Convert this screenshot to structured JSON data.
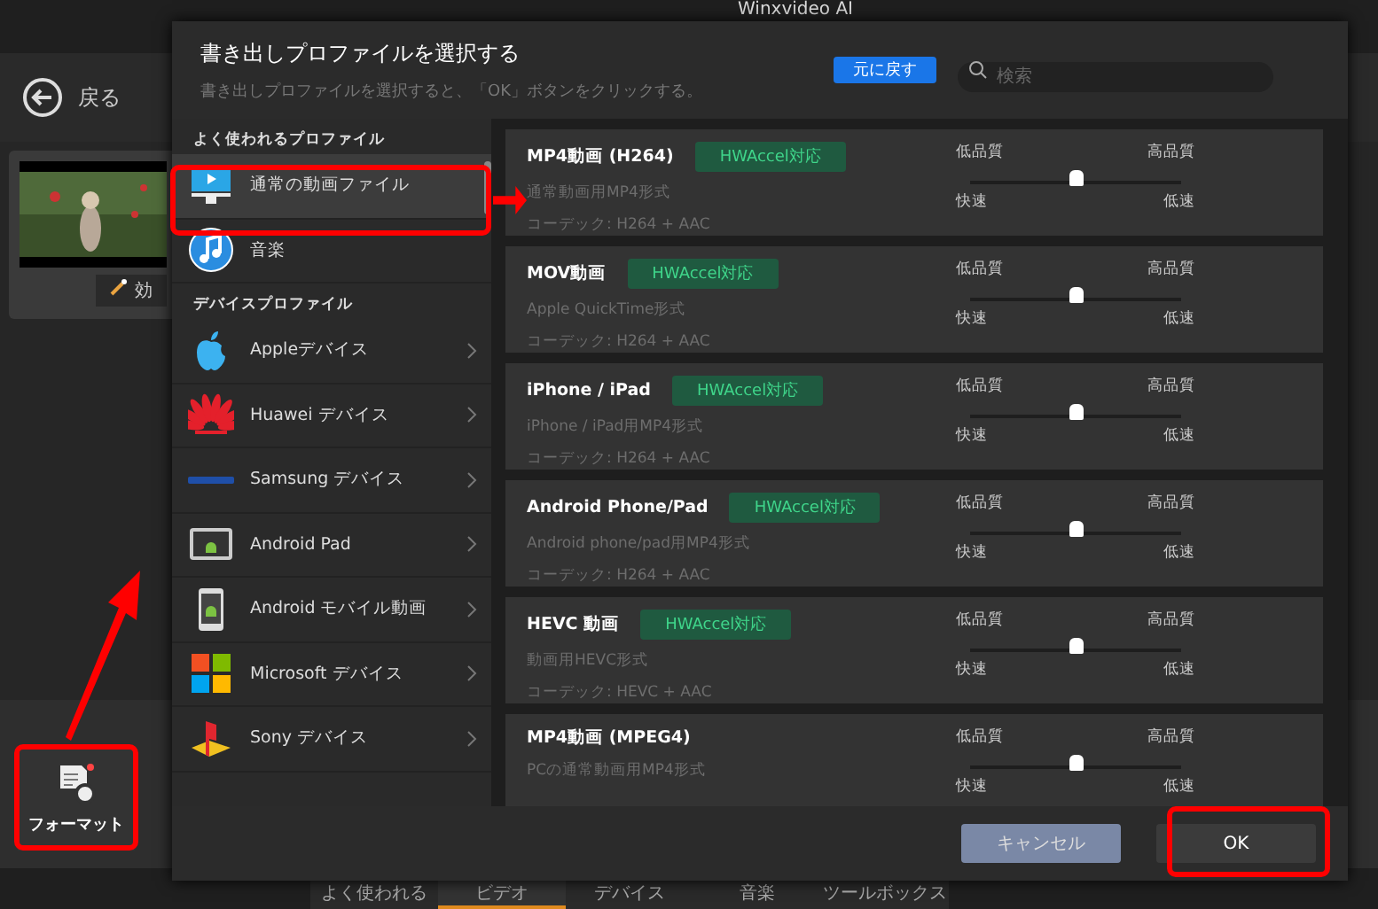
{
  "app": {
    "title": "Winxvideo AI",
    "back": "戻る",
    "effect_button": "効",
    "format_button": "フォーマット",
    "bottom_tabs": [
      {
        "label": "よく使われる",
        "selected": false
      },
      {
        "label": "ビデオ",
        "selected": true
      },
      {
        "label": "デバイス",
        "selected": false
      },
      {
        "label": "音楽",
        "selected": false
      },
      {
        "label": "ツールボックス",
        "selected": false
      }
    ]
  },
  "dialog": {
    "title": "書き出しプロファイルを選択する",
    "subtitle": "書き出しプロファイルを選択すると、「OK」ボタンをクリックする。",
    "reset_button": "元に戻す",
    "search": {
      "placeholder": "検索"
    },
    "sidebar": [
      {
        "kind": "header",
        "label": "よく使われるプロファイル"
      },
      {
        "kind": "item",
        "label": "通常の動画ファイル",
        "selected": true
      },
      {
        "kind": "item",
        "label": "音楽",
        "selected": false
      },
      {
        "kind": "header",
        "label": "デバイスプロファイル"
      },
      {
        "kind": "device",
        "label": "Appleデバイス",
        "selected": false
      },
      {
        "kind": "device",
        "label": "Huawei デバイス",
        "selected": false
      },
      {
        "kind": "device",
        "label": "Samsung デバイス",
        "selected": false
      },
      {
        "kind": "device",
        "label": "Android Pad",
        "selected": false
      },
      {
        "kind": "device",
        "label": "Android モバイル動画",
        "selected": false
      },
      {
        "kind": "device",
        "label": "Microsoft デバイス",
        "selected": false
      },
      {
        "kind": "device",
        "label": "Sony デバイス",
        "selected": false
      }
    ],
    "profiles": [
      {
        "title": "MP4動画 (H264)",
        "badge": "HWAccel対応",
        "description": "通常動画用MP4形式",
        "codec": "コーデック: H264 + AAC",
        "slider": {
          "level": 0.5,
          "low_quality": "低品質",
          "high_quality": "高品質",
          "fast": "快速",
          "slow": "低速"
        }
      },
      {
        "title": "MOV動画",
        "badge": "HWAccel対応",
        "description": "Apple QuickTime形式",
        "codec": "コーデック: H264 + AAC",
        "slider": {
          "level": 0.5,
          "low_quality": "低品質",
          "high_quality": "高品質",
          "fast": "快速",
          "slow": "低速"
        }
      },
      {
        "title": "iPhone / iPad",
        "badge": "HWAccel対応",
        "description": "iPhone / iPad用MP4形式",
        "codec": "コーデック: H264 + AAC",
        "slider": {
          "level": 0.5,
          "low_quality": "低品質",
          "high_quality": "高品質",
          "fast": "快速",
          "slow": "低速"
        }
      },
      {
        "title": "Android Phone/Pad",
        "badge": "HWAccel対応",
        "description": "Android phone/pad用MP4形式",
        "codec": "コーデック: H264 + AAC",
        "slider": {
          "level": 0.5,
          "low_quality": "低品質",
          "high_quality": "高品質",
          "fast": "快速",
          "slow": "低速"
        }
      },
      {
        "title": "HEVC 動画",
        "badge": "HWAccel対応",
        "description": "動画用HEVC形式",
        "codec": "コーデック: HEVC + AAC",
        "slider": {
          "level": 0.5,
          "low_quality": "低品質",
          "high_quality": "高品質",
          "fast": "快速",
          "slow": "低速"
        }
      },
      {
        "title": "MP4動画 (MPEG4)",
        "description": "PCの通常動画用MP4形式",
        "slider": {
          "level": 0.5,
          "low_quality": "低品質",
          "high_quality": "高品質",
          "fast": "快速",
          "slow": "低速"
        }
      }
    ],
    "cancel_button": "キャンセル",
    "ok_button": "OK"
  }
}
